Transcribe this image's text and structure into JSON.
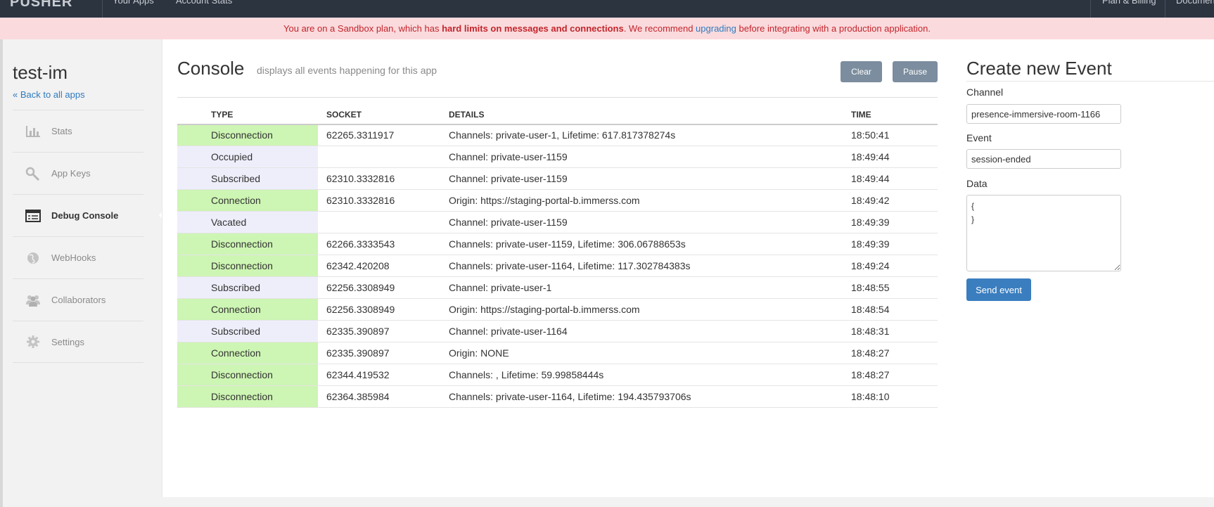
{
  "topnav": {
    "logo": "PUSHER",
    "links": [
      "Your Apps",
      "Account Stats"
    ],
    "right_links": [
      "Plan & Billing",
      "Documentation"
    ]
  },
  "banner": {
    "pre": "You are on a Sandbox plan, which has ",
    "bold": "hard limits on messages and connections",
    "mid": ". We recommend ",
    "link": "upgrading",
    "post": " before integrating with a production application."
  },
  "sidebar": {
    "app_name": "test-im",
    "back_link": "« Back to all apps",
    "items": [
      {
        "label": "Stats",
        "icon": "bar-chart-icon"
      },
      {
        "label": "App Keys",
        "icon": "key-icon"
      },
      {
        "label": "Debug Console",
        "icon": "console-icon"
      },
      {
        "label": "WebHooks",
        "icon": "globe-icon"
      },
      {
        "label": "Collaborators",
        "icon": "users-icon"
      },
      {
        "label": "Settings",
        "icon": "gear-icon"
      }
    ]
  },
  "console": {
    "title": "Console",
    "subtitle": "displays all events happening for this app",
    "clear_label": "Clear",
    "pause_label": "Pause",
    "columns": [
      "TYPE",
      "SOCKET",
      "DETAILS",
      "TIME"
    ],
    "rows": [
      {
        "type": "Disconnection",
        "socket": "62265.3311917",
        "details": "Channels: private-user-1, Lifetime: 617.817378274s",
        "time": "18:50:41"
      },
      {
        "type": "Occupied",
        "socket": "",
        "details": "Channel: private-user-1159",
        "time": "18:49:44"
      },
      {
        "type": "Subscribed",
        "socket": "62310.3332816",
        "details": "Channel: private-user-1159",
        "time": "18:49:44"
      },
      {
        "type": "Connection",
        "socket": "62310.3332816",
        "details": "Origin: https://staging-portal-b.immerss.com",
        "time": "18:49:42"
      },
      {
        "type": "Vacated",
        "socket": "",
        "details": "Channel: private-user-1159",
        "time": "18:49:39"
      },
      {
        "type": "Disconnection",
        "socket": "62266.3333543",
        "details": "Channels: private-user-1159, Lifetime: 306.06788653s",
        "time": "18:49:39"
      },
      {
        "type": "Disconnection",
        "socket": "62342.420208",
        "details": "Channels: private-user-1164, Lifetime: 117.302784383s",
        "time": "18:49:24"
      },
      {
        "type": "Subscribed",
        "socket": "62256.3308949",
        "details": "Channel: private-user-1",
        "time": "18:48:55"
      },
      {
        "type": "Connection",
        "socket": "62256.3308949",
        "details": "Origin: https://staging-portal-b.immerss.com",
        "time": "18:48:54"
      },
      {
        "type": "Subscribed",
        "socket": "62335.390897",
        "details": "Channel: private-user-1164",
        "time": "18:48:31"
      },
      {
        "type": "Connection",
        "socket": "62335.390897",
        "details": "Origin: NONE",
        "time": "18:48:27"
      },
      {
        "type": "Disconnection",
        "socket": "62344.419532",
        "details": "Channels: , Lifetime: 59.99858444s",
        "time": "18:48:27"
      },
      {
        "type": "Disconnection",
        "socket": "62364.385984",
        "details": "Channels: private-user-1164, Lifetime: 194.435793706s",
        "time": "18:48:10"
      }
    ]
  },
  "create_event": {
    "title": "Create new Event",
    "channel_label": "Channel",
    "channel_value": "presence-immersive-room-1166",
    "event_label": "Event",
    "event_value": "session-ended",
    "data_label": "Data",
    "data_value": "{\n}",
    "send_label": "Send event"
  },
  "colors": {
    "connection_bg": "#cdf5b3",
    "other_bg": "#eeeefb",
    "nav_bg": "#2c3440",
    "banner_bg": "#fadadd",
    "primary": "#3a7ebf"
  }
}
